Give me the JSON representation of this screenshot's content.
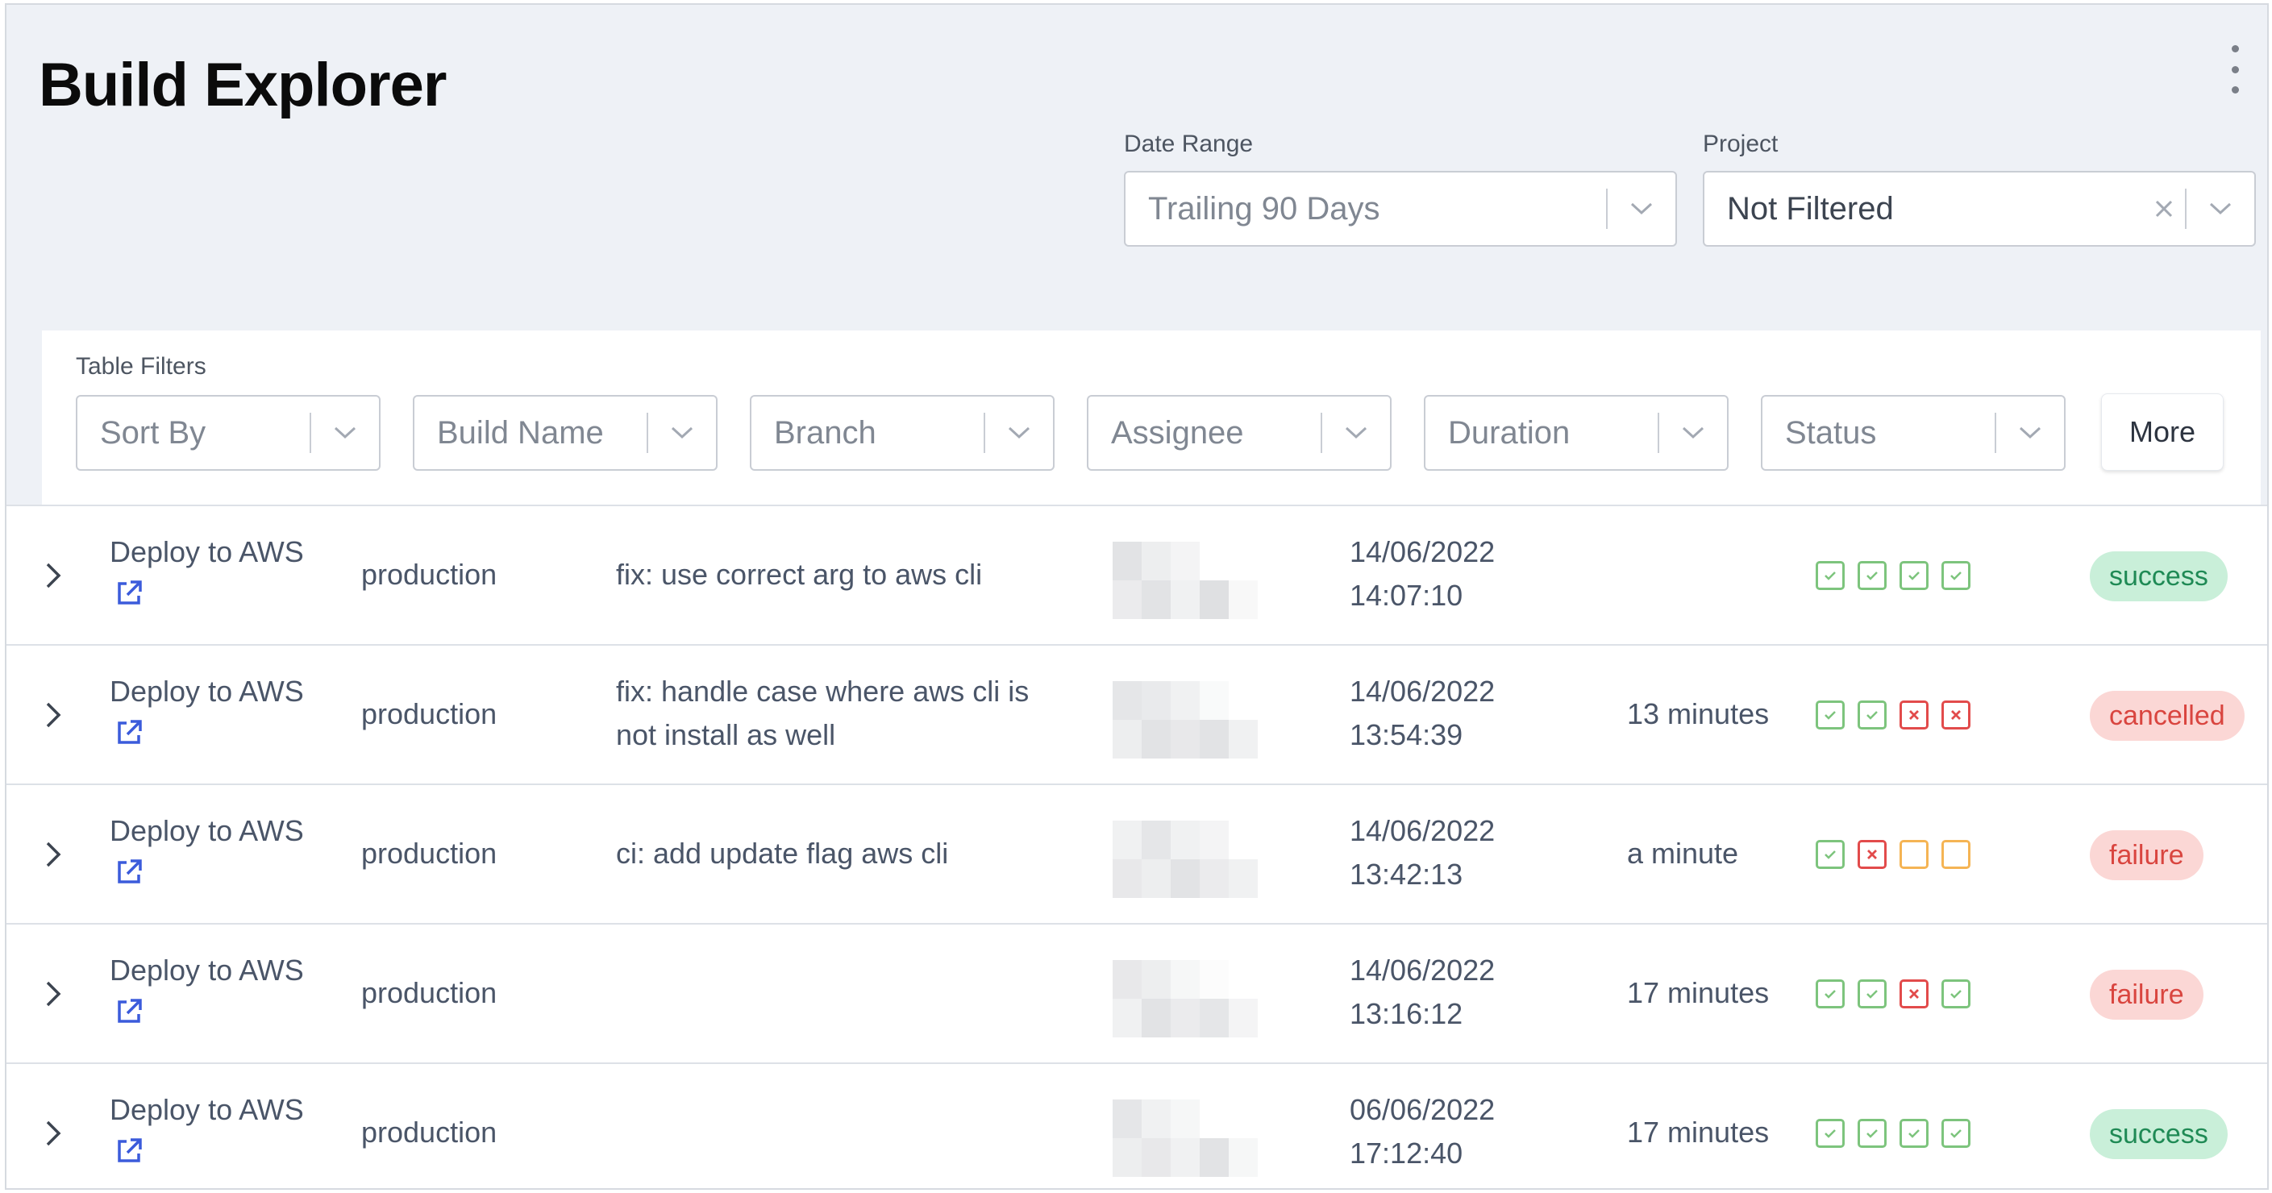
{
  "header": {
    "title": "Build Explorer",
    "date_range": {
      "label": "Date Range",
      "value": "Trailing 90 Days"
    },
    "project": {
      "label": "Project",
      "value": "Not Filtered"
    }
  },
  "table_filters": {
    "label": "Table Filters",
    "filters": [
      "Sort By",
      "Build Name",
      "Branch",
      "Assignee",
      "Duration",
      "Status"
    ],
    "more_label": "More"
  },
  "rows": [
    {
      "build": "Deploy to AWS",
      "branch": "production",
      "commit": "fix: use correct arg to aws cli",
      "date": "14/06/2022",
      "time": "14:07:10",
      "duration": "",
      "steps": [
        "ok",
        "ok",
        "ok",
        "ok"
      ],
      "status": "success"
    },
    {
      "build": "Deploy to AWS",
      "branch": "production",
      "commit": "fix: handle case where aws cli is not install as well",
      "date": "14/06/2022",
      "time": "13:54:39",
      "duration": "13 minutes",
      "steps": [
        "ok",
        "ok",
        "fail",
        "fail"
      ],
      "status": "cancelled"
    },
    {
      "build": "Deploy to AWS",
      "branch": "production",
      "commit": "ci: add update flag aws cli",
      "date": "14/06/2022",
      "time": "13:42:13",
      "duration": "a minute",
      "steps": [
        "ok",
        "fail",
        "pending",
        "pending"
      ],
      "status": "failure"
    },
    {
      "build": "Deploy to AWS",
      "branch": "production",
      "commit": "",
      "date": "14/06/2022",
      "time": "13:16:12",
      "duration": "17 minutes",
      "steps": [
        "ok",
        "ok",
        "fail",
        "ok"
      ],
      "status": "failure"
    },
    {
      "build": "Deploy to AWS",
      "branch": "production",
      "commit": "",
      "date": "06/06/2022",
      "time": "17:12:40",
      "duration": "17 minutes",
      "steps": [
        "ok",
        "ok",
        "ok",
        "ok"
      ],
      "status": "success"
    }
  ],
  "colors": {
    "header_bg": "#eef1f6",
    "success_bg": "#c9efd9",
    "success_text": "#1f8a55",
    "error_bg": "#fbd7d5",
    "error_text": "#d9453f",
    "step_ok": "#7dc47d",
    "step_fail": "#e24b4b",
    "step_pending": "#f5b454",
    "link": "#3b5bdb"
  },
  "icons": {
    "menu": "kebab-menu-icon",
    "dropdown": "chevron-down-icon",
    "clear": "close-icon",
    "expand": "chevron-right-icon",
    "external": "external-link-icon"
  }
}
